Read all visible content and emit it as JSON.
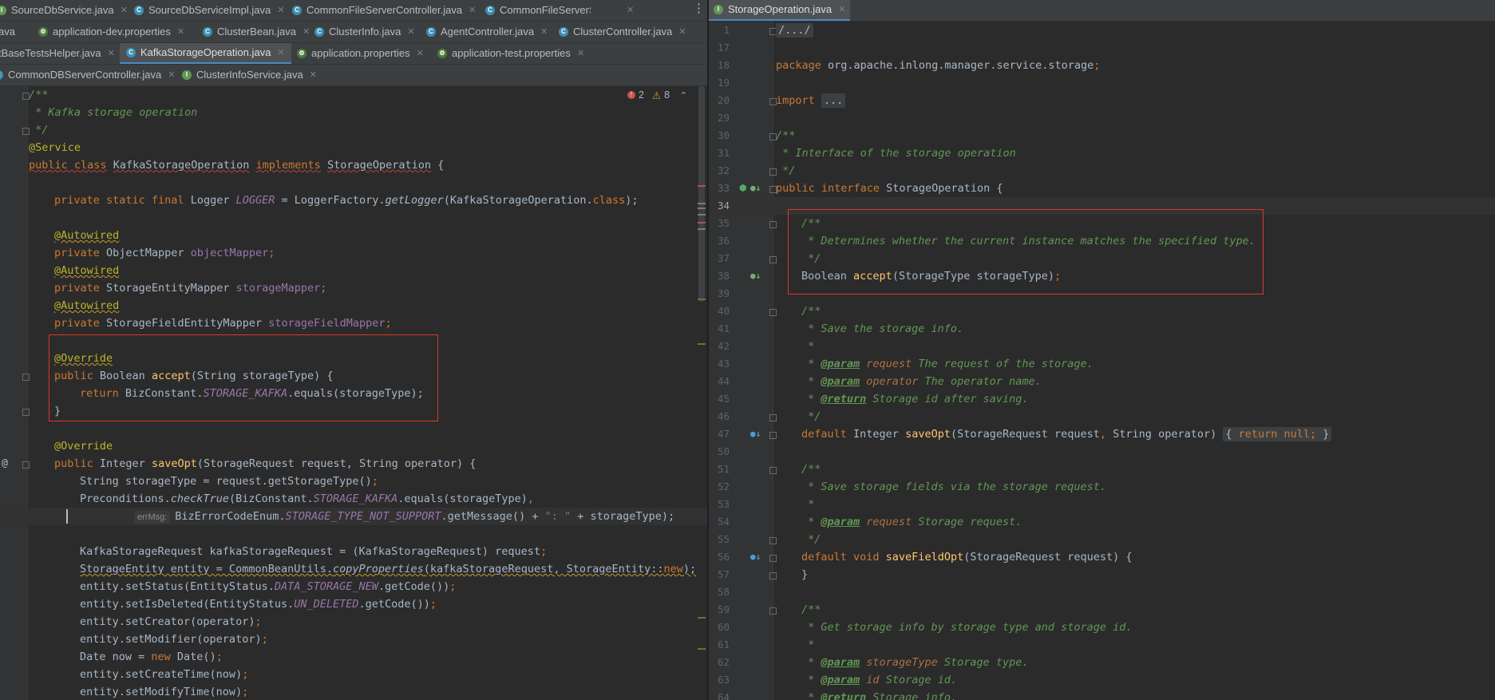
{
  "left_tabs": {
    "row1": [
      {
        "label": "SourceDbService.java",
        "icon": "interface-file-icon",
        "kind": "i"
      },
      {
        "label": "SourceDbServiceImpl.java",
        "icon": "class-file-icon",
        "kind": "c"
      },
      {
        "label": "CommonFileServerController.java",
        "icon": "class-file-icon",
        "kind": "c"
      },
      {
        "label": "CommonFileServerServiceImpl.java",
        "icon": "class-file-icon",
        "kind": "c"
      }
    ],
    "row2": [
      {
        "label": "ava",
        "icon": "",
        "kind": ""
      },
      {
        "label": "application-dev.properties",
        "icon": "properties-file-icon",
        "kind": "p"
      },
      {
        "label": "ClusterBean.java",
        "icon": "class-file-icon",
        "kind": "c"
      },
      {
        "label": "ClusterInfo.java",
        "icon": "class-file-icon",
        "kind": "c"
      },
      {
        "label": "AgentController.java",
        "icon": "class-file-icon",
        "kind": "c"
      },
      {
        "label": "ClusterController.java",
        "icon": "class-file-icon",
        "kind": "c"
      }
    ],
    "row3": [
      {
        "label": "tBaseTestsHelper.java",
        "icon": "",
        "kind": ""
      },
      {
        "label": "KafkaStorageOperation.java",
        "icon": "class-file-icon",
        "kind": "c"
      },
      {
        "label": "application.properties",
        "icon": "properties-file-icon",
        "kind": "p"
      },
      {
        "label": "application-test.properties",
        "icon": "properties-file-icon",
        "kind": "p"
      }
    ],
    "row4": [
      {
        "label": "CommonDBServerController.java",
        "icon": "class-file-icon",
        "kind": "c"
      },
      {
        "label": "ClusterInfoService.java",
        "icon": "interface-file-icon",
        "kind": "i"
      }
    ]
  },
  "right_tab": {
    "label": "StorageOperation.java"
  },
  "inspections": {
    "errors": "2",
    "warnings": "8"
  },
  "left_code": {
    "l1": "/**",
    "l2": " * Kafka storage operation",
    "l3": " */",
    "l4": "@Service",
    "l5a": "public class",
    "l5b": "KafkaStorageOperation",
    "l5c": "implements",
    "l5d": "StorageOperation",
    "l5e": " {",
    "l7a": "private static final",
    "l7b": " Logger ",
    "l7c": "LOGGER",
    "l7d": " = LoggerFactory.",
    "l7e": "getLogger",
    "l7f": "(KafkaStorageOperation.",
    "l7g": "class",
    "l7h": ");",
    "l9": "@Autowired",
    "l10a": "private",
    "l10b": " ObjectMapper ",
    "l10c": "objectMapper",
    "l10d": ";",
    "l11": "@Autowired",
    "l12a": "private",
    "l12b": " StorageEntityMapper ",
    "l12c": "storageMapper",
    "l12d": ";",
    "l13": "@Autowired",
    "l14a": "private",
    "l14b": " StorageFieldEntityMapper ",
    "l14c": "storageFieldMapper",
    "l14d": ";",
    "l16": "@Override",
    "l17a": "public",
    "l17b": " Boolean ",
    "l17c": "accept",
    "l17d": "(String storageType) {",
    "l18a": "return",
    "l18b": " BizConstant.",
    "l18c": "STORAGE_KAFKA",
    "l18d": ".equals(storageType);",
    "l19": "}",
    "l21": "@Override",
    "l22a": "public",
    "l22b": " Integer ",
    "l22c": "saveOpt",
    "l22d": "(StorageRequest request, String operator) {",
    "l23a": "String storageType = request.getStorageType()",
    "l23b": ";",
    "l24a": "Preconditions.",
    "l24b": "checkTrue",
    "l24c": "(BizConstant.",
    "l24d": "STORAGE_KAFKA",
    "l24e": ".equals(storageType)",
    "l24f": ",",
    "l25hint": "errMsg:",
    "l25a": "BizErrorCodeEnum.",
    "l25b": "STORAGE_TYPE_NOT_SUPPORT",
    "l25c": ".getMessage() + ",
    "l25d": "\": \"",
    "l25e": " + storageType);",
    "l27a": "KafkaStorageRequest kafkaStorageRequest = (KafkaStorageRequest) request",
    "l27b": ";",
    "l28a": "StorageEntity entity = CommonBeanUtils.",
    "l28b": "copyProperties",
    "l28c": "(kafkaStorageRequest, StorageEntity::",
    "l28d": "new",
    "l28e": ");",
    "l29a": "entity.setStatus(EntityStatus.",
    "l29b": "DATA_STORAGE_NEW",
    "l29c": ".getCode())",
    "l29d": ";",
    "l30a": "entity.setIsDeleted(EntityStatus.",
    "l30b": "UN_DELETED",
    "l30c": ".getCode())",
    "l30d": ";",
    "l31a": "entity.setCreator(operator)",
    "l31b": ";",
    "l32a": "entity.setModifier(operator)",
    "l32b": ";",
    "l33a": "Date now = ",
    "l33b": "new",
    "l33c": " Date()",
    "l33d": ";",
    "l34a": "entity.setCreateTime(now)",
    "l34b": ";",
    "l35a": "entity.setModifyTime(now)",
    "l35b": ";"
  },
  "right_code": {
    "n1": "1",
    "r1": "/.../",
    "n17": "17",
    "n18": "18",
    "r18a": "package",
    "r18b": " org.apache.inlong.manager.service.storage",
    "r18c": ";",
    "n19": "19",
    "n20": "20",
    "r20a": "import",
    "r20b": "...",
    "n29": "29",
    "n30": "30",
    "r30": "/**",
    "n31": "31",
    "r31": " * Interface of the storage operation",
    "n32": "32",
    "r32": " */",
    "n33": "33",
    "r33a": "public interface",
    "r33b": " StorageOperation {",
    "n34": "34",
    "n35": "35",
    "r35": "/**",
    "n36": "36",
    "r36": " * Determines whether the current instance matches the specified type.",
    "n37": "37",
    "r37": " */",
    "n38": "38",
    "r38a": "Boolean ",
    "r38b": "accept",
    "r38c": "(StorageType storageType)",
    "r38d": ";",
    "n39": "39",
    "n40": "40",
    "r40": "/**",
    "n41": "41",
    "r41": " * Save the storage info.",
    "n42": "42",
    "r42": " *",
    "n43": "43",
    "r43a": " * ",
    "r43b": "@param",
    "r43c": " request",
    "r43d": " The request of the storage.",
    "n44": "44",
    "r44a": " * ",
    "r44b": "@param",
    "r44c": " operator",
    "r44d": " The operator name.",
    "n45": "45",
    "r45a": " * ",
    "r45b": "@return",
    "r45c": " Storage id after saving.",
    "n46": "46",
    "r46": " */",
    "n47": "47",
    "r47a": "default",
    "r47b": " Integer ",
    "r47c": "saveOpt",
    "r47d": "(StorageRequest request",
    "r47e": ", ",
    "r47f": "String operator)",
    "r47g": "{ ",
    "r47h": "return null;",
    "r47i": " }",
    "n50": "50",
    "n51": "51",
    "r51": "/**",
    "n52": "52",
    "r52": " * Save storage fields via the storage request.",
    "n53": "53",
    "r53": " *",
    "n54": "54",
    "r54a": " * ",
    "r54b": "@param",
    "r54c": " request",
    "r54d": " Storage request.",
    "n55": "55",
    "r55": " */",
    "n56": "56",
    "r56a": "default void ",
    "r56b": "saveFieldOpt",
    "r56c": "(StorageRequest request) {",
    "n57": "57",
    "r57": "}",
    "n58": "58",
    "n59": "59",
    "r59": "/**",
    "n60": "60",
    "r60": " * Get storage info by storage type and storage id.",
    "n61": "61",
    "r61": " *",
    "n62": "62",
    "r62a": " * ",
    "r62b": "@param",
    "r62c": " storageType",
    "r62d": " Storage type.",
    "n63": "63",
    "r63a": " * ",
    "r63b": "@param",
    "r63c": " id",
    "r63d": " Storage id.",
    "n64": "64",
    "r64a": " * ",
    "r64b": "@return",
    "r64c": " Storage info."
  },
  "colors": {
    "highlight_box": "#e0342b",
    "active_tab_underline": "#4a88c7",
    "editor_bg": "#2b2b2b"
  }
}
